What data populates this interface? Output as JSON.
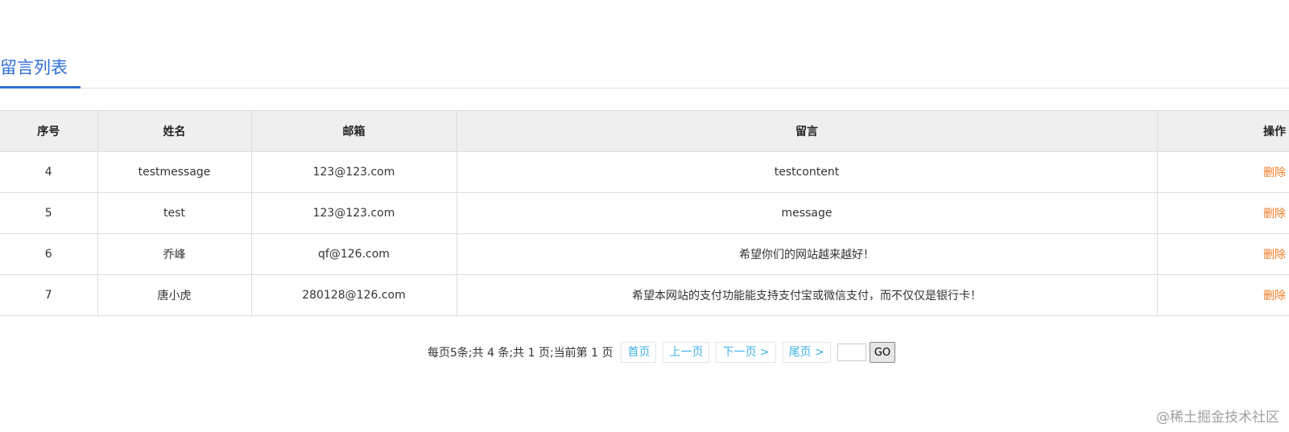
{
  "page": {
    "title": "留言列表"
  },
  "table": {
    "headers": {
      "index": "序号",
      "name": "姓名",
      "email": "邮箱",
      "message": "留言",
      "action": "操作"
    },
    "rows": [
      {
        "index": "4",
        "name": "testmessage",
        "email": "123@123.com",
        "message": "testcontent",
        "action": "删除"
      },
      {
        "index": "5",
        "name": "test",
        "email": "123@123.com",
        "message": "message",
        "action": "删除"
      },
      {
        "index": "6",
        "name": "乔峰",
        "email": "qf@126.com",
        "message": "希望你们的网站越来越好！",
        "action": "删除"
      },
      {
        "index": "7",
        "name": "唐小虎",
        "email": "280128@126.com",
        "message": "希望本网站的支付功能能支持支付宝或微信支付，而不仅仅是银行卡！",
        "action": "删除"
      }
    ]
  },
  "pagination": {
    "info": "每页5条;共 4 条;共 1 页;当前第 1 页",
    "first": "首页",
    "prev": "上一页",
    "next": "下一页 >",
    "last": "尾页 >",
    "page_input_value": "",
    "go": "GO"
  },
  "watermark": "@稀土掘金技术社区",
  "colors": {
    "accent": "#2f6fd6",
    "delete_link": "#f07a22",
    "pager_link": "#3db0e8",
    "header_bg": "#efefef"
  }
}
